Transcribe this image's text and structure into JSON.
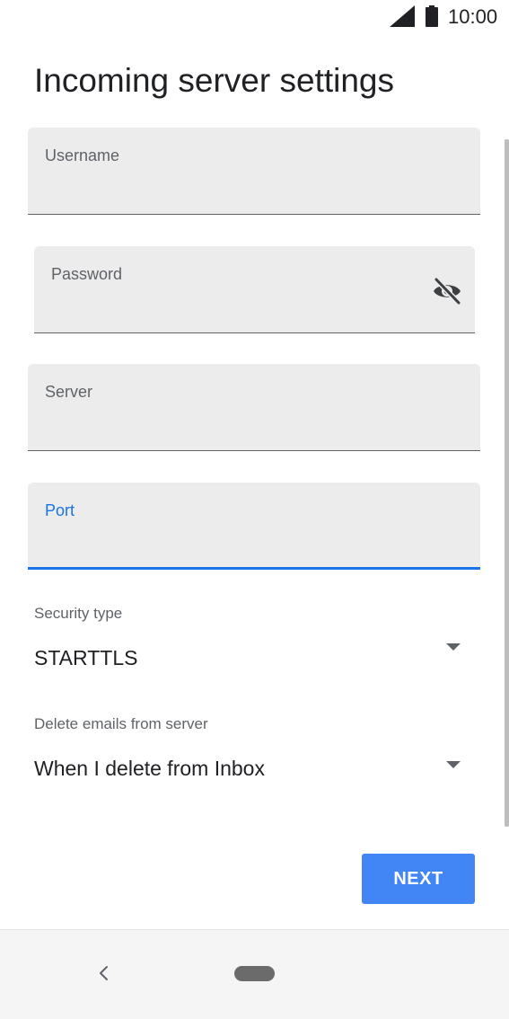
{
  "status_bar": {
    "time": "10:00",
    "icons": [
      "signal-icon",
      "battery-icon"
    ]
  },
  "page": {
    "title": "Incoming server settings"
  },
  "fields": {
    "username": {
      "label": "Username",
      "value": ""
    },
    "password": {
      "label": "Password",
      "value": "",
      "toggle_icon": "visibility-off-icon"
    },
    "server": {
      "label": "Server",
      "value": ""
    },
    "port": {
      "label": "Port",
      "value": "",
      "focused": true
    }
  },
  "dropdowns": {
    "security": {
      "label": "Security type",
      "value": "STARTTLS",
      "icon": "dropdown-arrow-icon"
    },
    "delete": {
      "label": "Delete emails from server",
      "value": "When I delete from Inbox",
      "icon": "dropdown-arrow-icon"
    }
  },
  "actions": {
    "next_label": "NEXT"
  },
  "nav_bar": {
    "icons": [
      "back-icon",
      "home-pill"
    ]
  },
  "colors": {
    "accent": "#1a73e8",
    "button": "#4285f4",
    "field_background": "#ececec"
  }
}
